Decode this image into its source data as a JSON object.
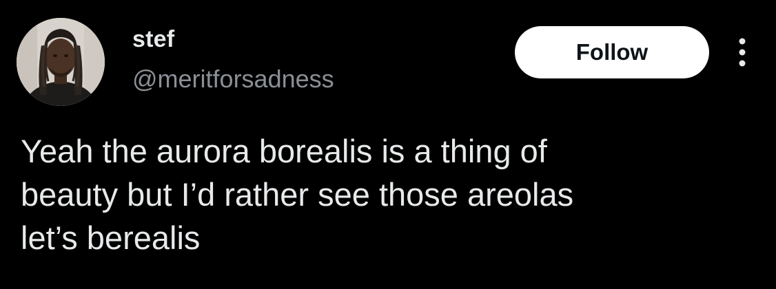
{
  "user": {
    "name": "stef",
    "handle": "@meritforsadness",
    "avatar_icon": "profile-photo"
  },
  "actions": {
    "follow_label": "Follow",
    "more_icon": "more-vertical-icon"
  },
  "tweet": {
    "lines": [
      "Yeah the aurora borealis is a thing of",
      "beauty but I’d rather see those areolas",
      "let’s berealis"
    ]
  },
  "colors": {
    "background": "#000000",
    "text_primary": "#e7e9ea",
    "text_secondary": "#8b9096",
    "button_bg": "#ffffff",
    "button_text": "#0f1419"
  }
}
